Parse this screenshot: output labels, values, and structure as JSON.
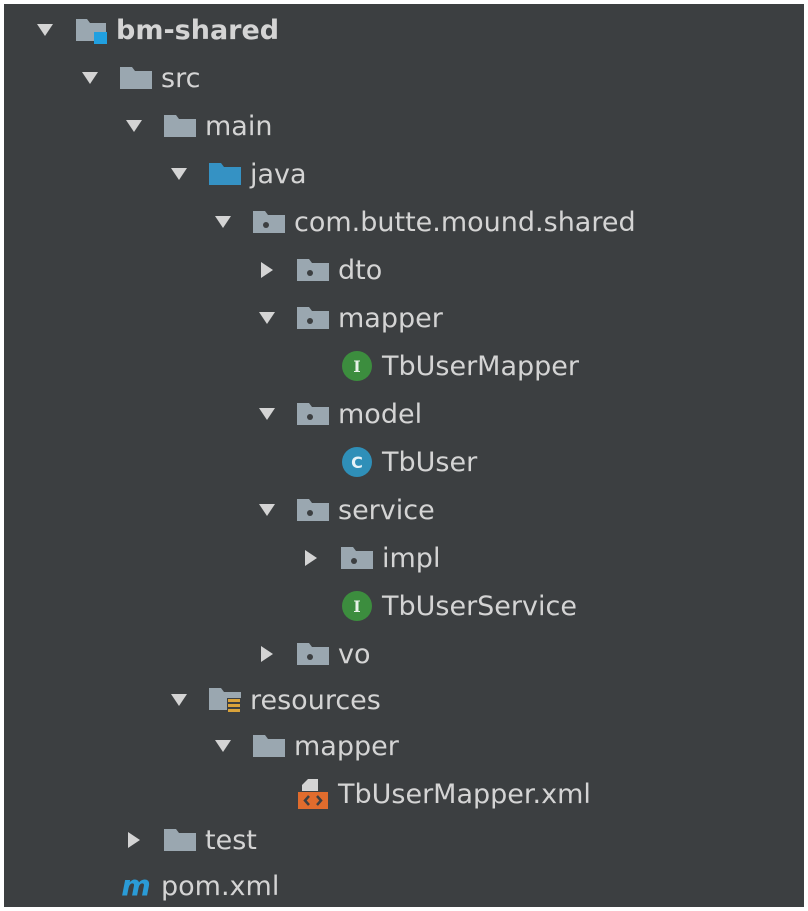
{
  "colors": {
    "background": "#3c3f41",
    "text": "#d4d4d4",
    "folder_gray": "#9aa7b0",
    "folder_blue": "#3592c4",
    "interface_green": "#3c8d3e",
    "class_blue": "#2f8fb8",
    "maven_blue": "#2a9bd6",
    "xml_orange": "#e06c2d",
    "resource_yellow": "#d9a23a"
  },
  "tree": [
    {
      "label": "bm-shared",
      "icon": "module-folder-icon",
      "toggle": "expanded"
    },
    {
      "label": "src",
      "icon": "folder-icon",
      "toggle": "expanded"
    },
    {
      "label": "main",
      "icon": "folder-icon",
      "toggle": "expanded"
    },
    {
      "label": "java",
      "icon": "source-root-folder-icon",
      "toggle": "expanded"
    },
    {
      "label": "com.butte.mound.shared",
      "icon": "package-icon",
      "toggle": "expanded"
    },
    {
      "label": "dto",
      "icon": "package-icon",
      "toggle": "collapsed"
    },
    {
      "label": "mapper",
      "icon": "package-icon",
      "toggle": "expanded"
    },
    {
      "label": "TbUserMapper",
      "icon": "interface-icon",
      "toggle": "none"
    },
    {
      "label": "model",
      "icon": "package-icon",
      "toggle": "expanded"
    },
    {
      "label": "TbUser",
      "icon": "class-icon",
      "toggle": "none"
    },
    {
      "label": "service",
      "icon": "package-icon",
      "toggle": "expanded"
    },
    {
      "label": "impl",
      "icon": "package-icon",
      "toggle": "collapsed"
    },
    {
      "label": "TbUserService",
      "icon": "interface-icon",
      "toggle": "none"
    },
    {
      "label": "vo",
      "icon": "package-icon",
      "toggle": "collapsed"
    },
    {
      "label": "resources",
      "icon": "resources-folder-icon",
      "toggle": "expanded"
    },
    {
      "label": "mapper",
      "icon": "folder-icon",
      "toggle": "expanded"
    },
    {
      "label": "TbUserMapper.xml",
      "icon": "xml-file-icon",
      "toggle": "none"
    },
    {
      "label": "test",
      "icon": "folder-icon",
      "toggle": "collapsed"
    },
    {
      "label": "pom.xml",
      "icon": "maven-icon",
      "toggle": "none"
    }
  ]
}
